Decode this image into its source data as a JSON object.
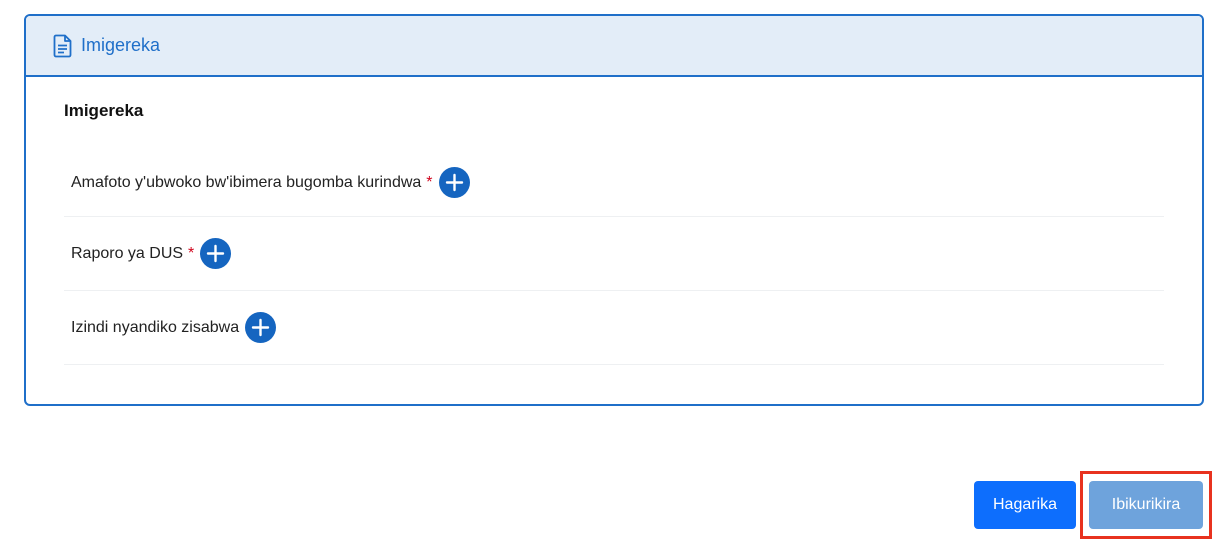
{
  "card": {
    "header_title": "Imigereka",
    "section_title": "Imigereka",
    "documents": [
      {
        "label": "Amafoto y'ubwoko bw'ibimera bugomba kurindwa",
        "required_mark": "*"
      },
      {
        "label": "Raporo ya DUS",
        "required_mark": "*"
      },
      {
        "label": "Izindi nyandiko zisabwa",
        "required_mark": ""
      }
    ]
  },
  "footer": {
    "cancel_label": "Hagarika",
    "submit_label": "Ibikurikira"
  },
  "icons": {
    "header_icon": "document-icon",
    "add_icon": "plus-circle-icon"
  },
  "colors": {
    "primary": "#1f6fc9",
    "header_bg": "#e3edf8",
    "required": "#d0021b",
    "cancel_bg": "#0d6efd",
    "submit_bg": "#6ea3dc",
    "highlight": "#e8321f"
  }
}
